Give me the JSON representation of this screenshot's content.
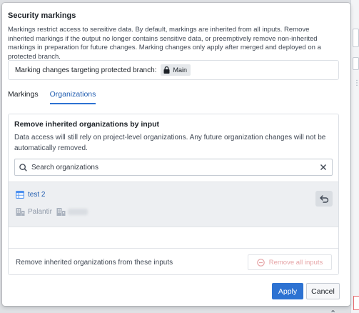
{
  "dialog": {
    "title": "Security markings",
    "description": "Markings restrict access to sensitive data. By default, markings are inherited from all inputs. Remove inherited markings if the output no longer contains sensitive data, or preemptively remove non-inherited markings in preparation for future changes. Marking changes only apply after merged and deployed on a protected branch."
  },
  "branch": {
    "label": "Marking changes targeting protected branch:",
    "tag": "Main",
    "icon": "lock-icon"
  },
  "tabs": [
    {
      "label": "Markings",
      "active": false
    },
    {
      "label": "Organizations",
      "active": true
    }
  ],
  "panel": {
    "title": "Remove inherited organizations by input",
    "subtitle": "Data access will still rely on project-level organizations. Any future organization changes will not be automatically removed.",
    "search": {
      "placeholder": "Search organizations",
      "value": ""
    },
    "items": [
      {
        "name": "test 2",
        "icon": "dataset-table-icon",
        "organizations": [
          "Palantir",
          ""
        ]
      }
    ],
    "footer_label": "Remove inherited organizations from these inputs",
    "remove_all_label": "Remove all inputs"
  },
  "buttons": {
    "apply": "Apply",
    "cancel": "Cancel"
  },
  "colors": {
    "primary": "#2d72d2",
    "link": "#215db0",
    "danger_disabled": "#e6a4a6"
  }
}
